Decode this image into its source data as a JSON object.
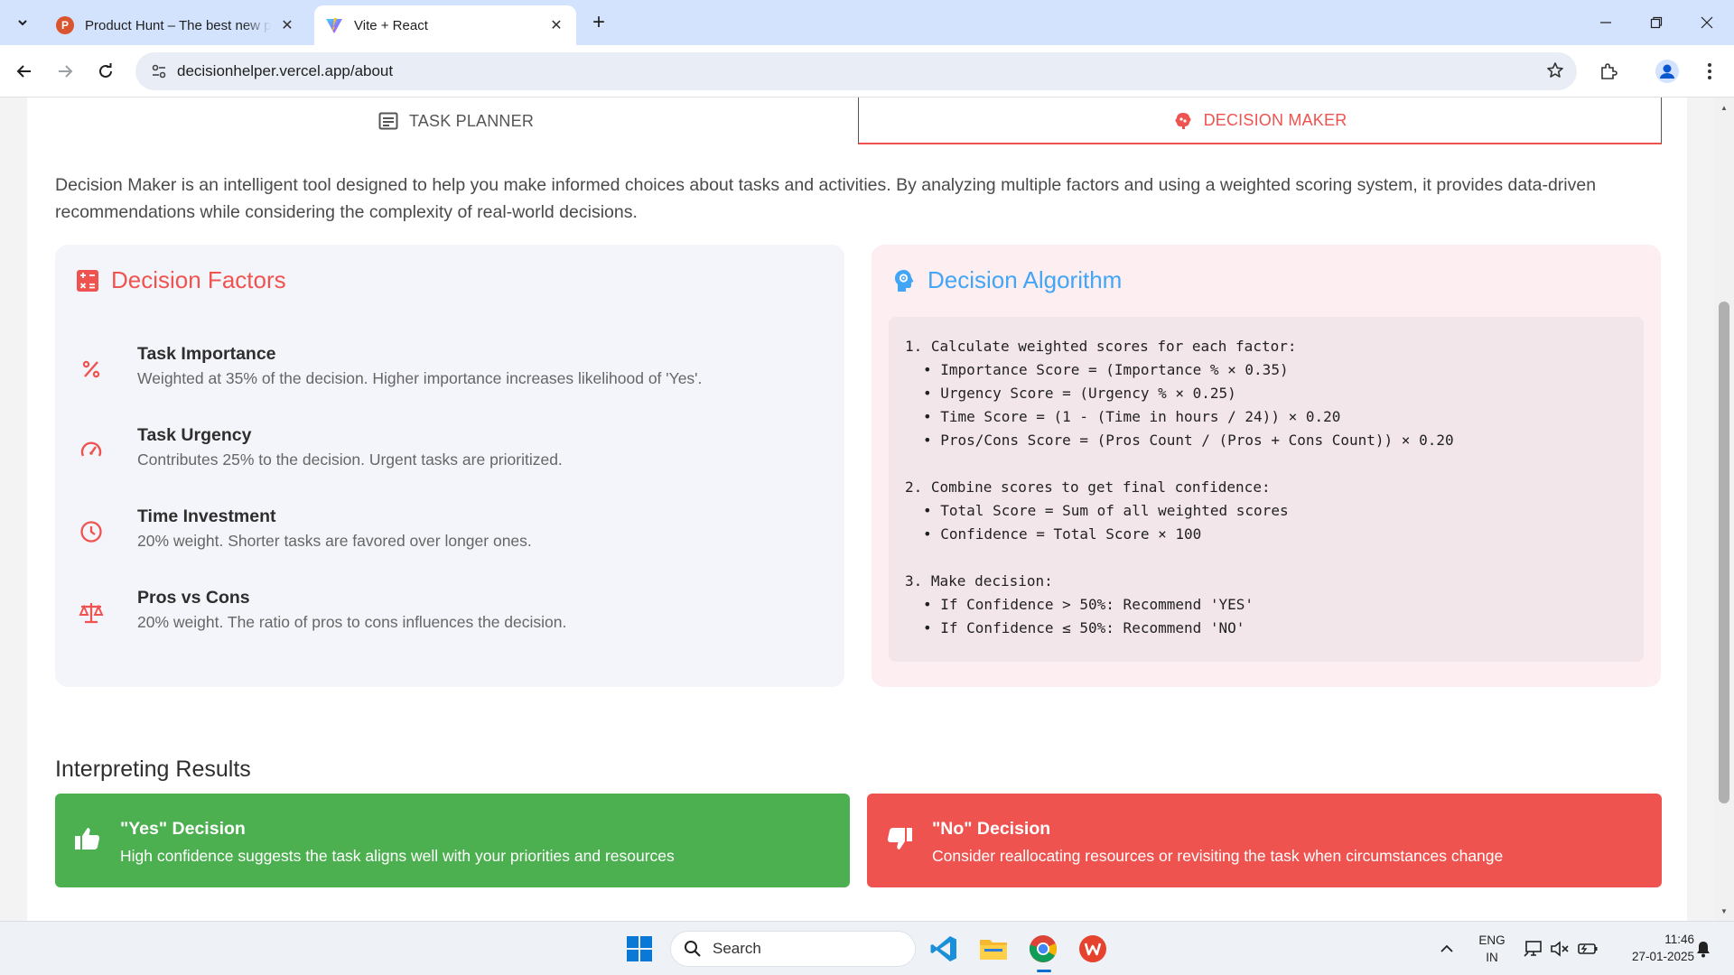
{
  "browser": {
    "tabs": [
      {
        "title": "Product Hunt – The best new products",
        "active": false
      },
      {
        "title": "Vite + React",
        "active": true
      }
    ],
    "url": "decisionhelper.vercel.app/about"
  },
  "page": {
    "nav_tabs": {
      "planner": "TASK PLANNER",
      "maker": "DECISION MAKER"
    },
    "intro": "Decision Maker is an intelligent tool designed to help you make informed choices about tasks and activities. By analyzing multiple factors and using a weighted scoring system, it provides data-driven recommendations while considering the complexity of real-world decisions.",
    "factors": {
      "title": "Decision Factors",
      "items": [
        {
          "icon": "percent-icon",
          "title": "Task Importance",
          "desc": "Weighted at 35% of the decision. Higher importance increases likelihood of 'Yes'."
        },
        {
          "icon": "speedometer-icon",
          "title": "Task Urgency",
          "desc": "Contributes 25% to the decision. Urgent tasks are prioritized."
        },
        {
          "icon": "clock-icon",
          "title": "Time Investment",
          "desc": "20% weight. Shorter tasks are favored over longer ones."
        },
        {
          "icon": "scale-icon",
          "title": "Pros vs Cons",
          "desc": "20% weight. The ratio of pros to cons influences the decision."
        }
      ]
    },
    "algorithm": {
      "title": "Decision Algorithm",
      "steps": [
        {
          "title": "1. Calculate weighted scores for each factor:",
          "bullets": [
            "• Importance Score = (Importance % × 0.35)",
            "• Urgency Score = (Urgency % × 0.25)",
            "• Time Score = (1 - (Time in hours / 24)) × 0.20",
            "• Pros/Cons Score = (Pros Count / (Pros + Cons Count)) × 0.20"
          ]
        },
        {
          "title": "2. Combine scores to get final confidence:",
          "bullets": [
            "• Total Score = Sum of all weighted scores",
            "• Confidence = Total Score × 100"
          ]
        },
        {
          "title": "3. Make decision:",
          "bullets": [
            "• If Confidence > 50%: Recommend 'YES'",
            "• If Confidence ≤ 50%: Recommend 'NO'"
          ]
        }
      ]
    },
    "interpreting": {
      "title": "Interpreting Results",
      "yes": {
        "title": "\"Yes\" Decision",
        "desc": "High confidence suggests the task aligns well with your priorities and resources"
      },
      "no": {
        "title": "\"No\" Decision",
        "desc": "Consider reallocating resources or revisiting the task when circumstances change"
      }
    }
  },
  "taskbar": {
    "search_label": "Search",
    "lang_line1": "ENG",
    "lang_line2": "IN",
    "time": "11:46",
    "date": "27-01-2025"
  },
  "colors": {
    "accent_red": "#ef5350",
    "accent_blue": "#42a5f5",
    "yes_green": "#4caf50",
    "no_red": "#ef5350"
  }
}
